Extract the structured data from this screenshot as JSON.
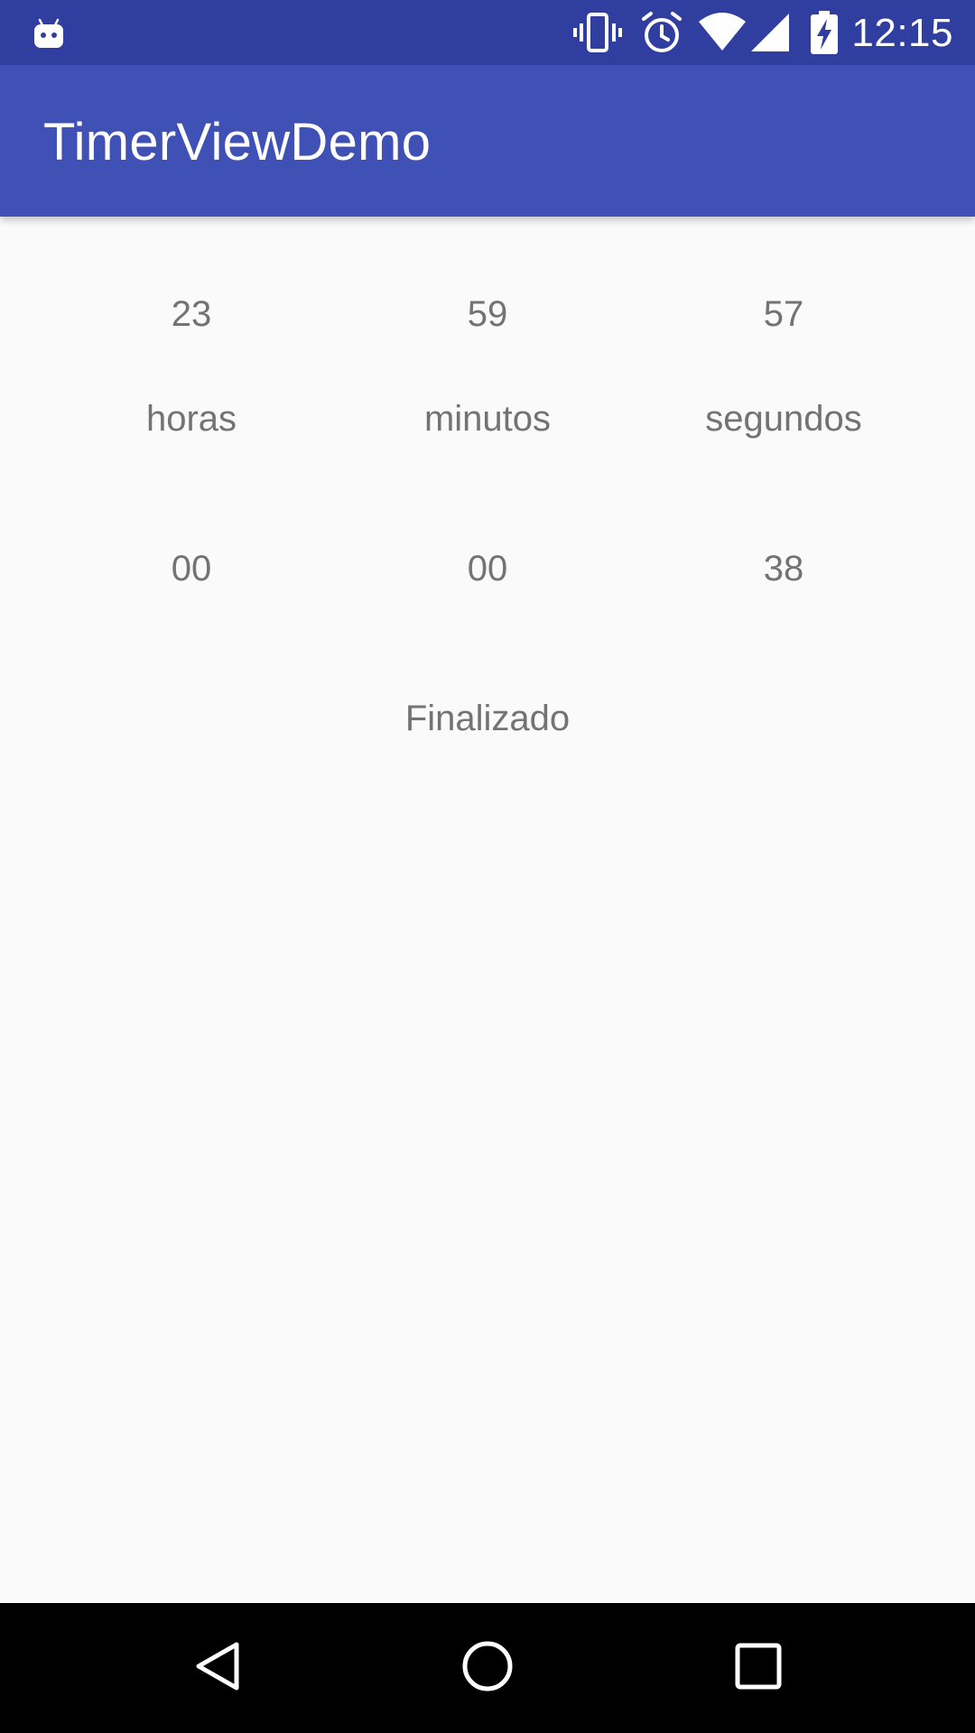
{
  "status_bar": {
    "time": "12:15",
    "icons": [
      "android-notification-icon",
      "vibrate-icon",
      "alarm-icon",
      "wifi-icon",
      "signal-icon",
      "battery-charging-icon"
    ]
  },
  "app_bar": {
    "title": "TimerViewDemo"
  },
  "timer": {
    "remaining": {
      "hours": "23",
      "minutes": "59",
      "seconds": "57"
    },
    "labels": {
      "hours": "horas",
      "minutes": "minutos",
      "seconds": "segundos"
    },
    "elapsed": {
      "hours": "00",
      "minutes": "00",
      "seconds": "38"
    },
    "status": "Finalizado"
  },
  "nav_bar": {
    "buttons": [
      "back-icon",
      "home-icon",
      "recents-icon"
    ]
  },
  "colors": {
    "status_bar": "#303f9f",
    "app_bar": "#3f51b5",
    "background": "#fafafa",
    "text": "#737373",
    "nav_bar": "#000000"
  }
}
